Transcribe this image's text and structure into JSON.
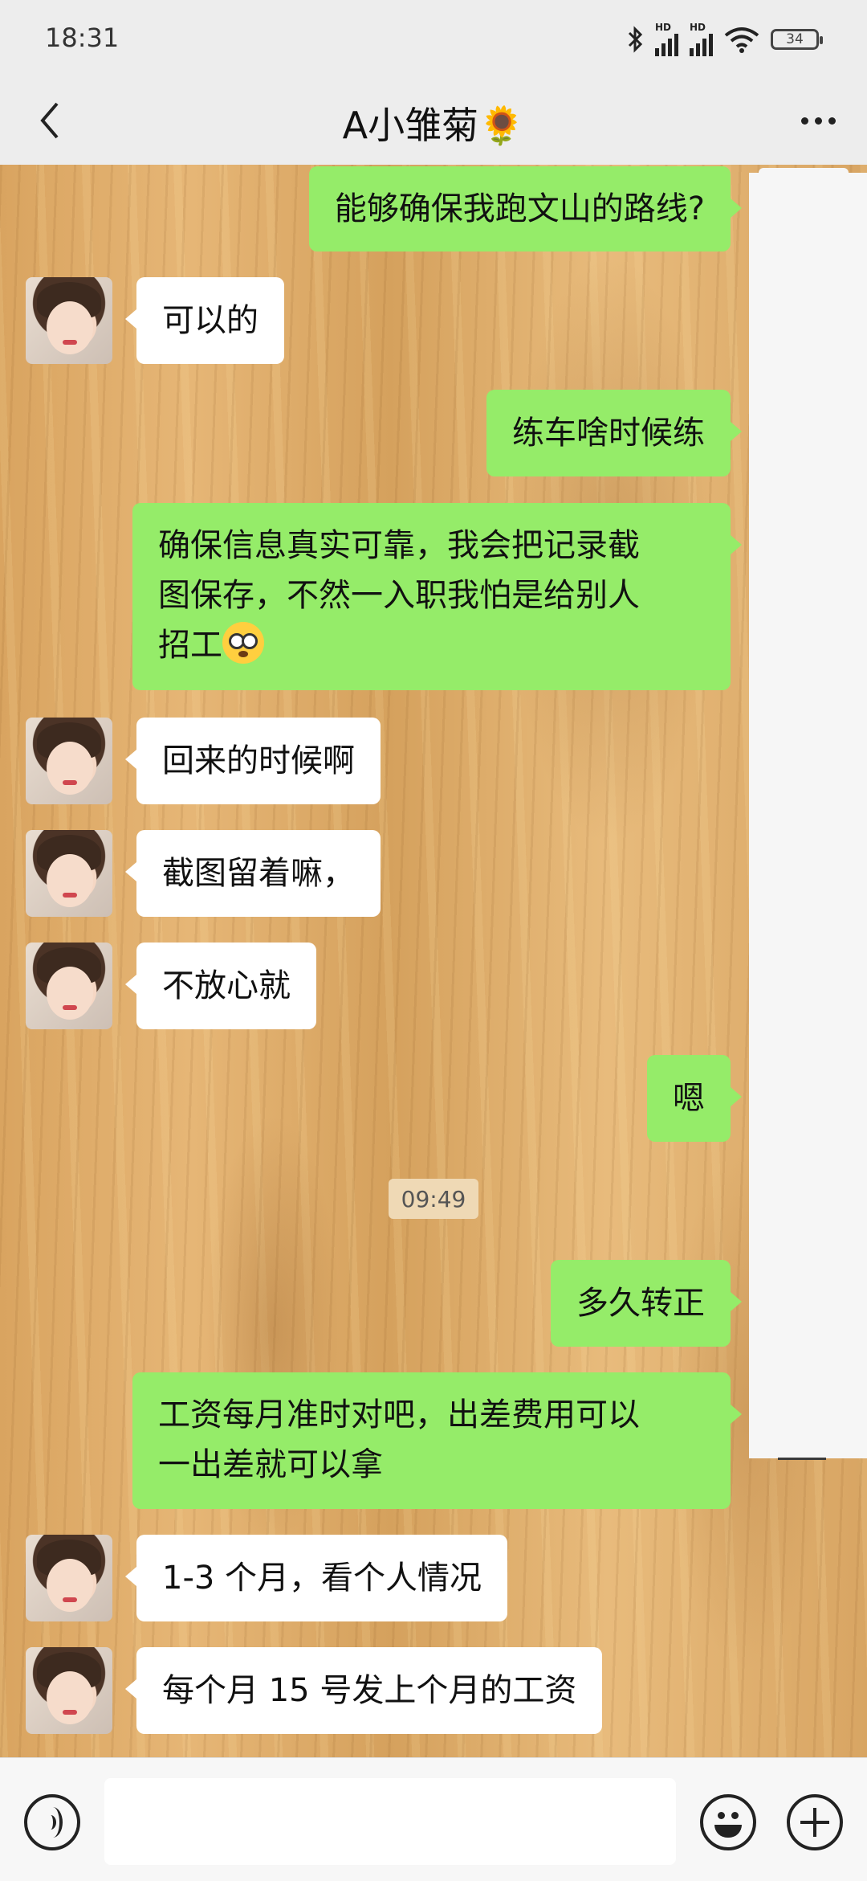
{
  "status_bar": {
    "time": "18:31",
    "battery": "34",
    "hd1": "HD",
    "hd2": "HD"
  },
  "header": {
    "title": "A小雏菊🌻"
  },
  "messages": [
    {
      "side": "right",
      "text": "能够确保我跑文山的路线?"
    },
    {
      "side": "left",
      "text": "可以的"
    },
    {
      "side": "right",
      "text": "练车啥时候练"
    },
    {
      "side": "right",
      "line1": "确保信息真实可靠，我会把记录截",
      "line2": "图保存，不然一入职我怕是给别人",
      "line3": "招工",
      "emoji": "flushed-face"
    },
    {
      "side": "left",
      "text": "回来的时候啊"
    },
    {
      "side": "left",
      "text": "截图留着嘛，"
    },
    {
      "side": "left",
      "text": "不放心就"
    },
    {
      "side": "right",
      "text": "嗯"
    },
    {
      "side": "right",
      "text": "多久转正"
    },
    {
      "side": "right",
      "line1": "工资每月准时对吧，出差费用可以",
      "line2": "一出差就可以拿"
    },
    {
      "side": "left",
      "text": "1-3 个月，看个人情况"
    },
    {
      "side": "left",
      "text": "每个月 15 号发上个月的工资"
    }
  ],
  "timestamp": "09:49",
  "colors": {
    "sent_bubble": "#95ec69",
    "received_bubble": "#ffffff",
    "bar_bg": "#ededed"
  },
  "icons": {
    "back": "chevron-left-icon",
    "more": "more-dots-icon",
    "voice": "voice-icon",
    "emoji": "emoji-icon",
    "plus": "plus-icon"
  }
}
